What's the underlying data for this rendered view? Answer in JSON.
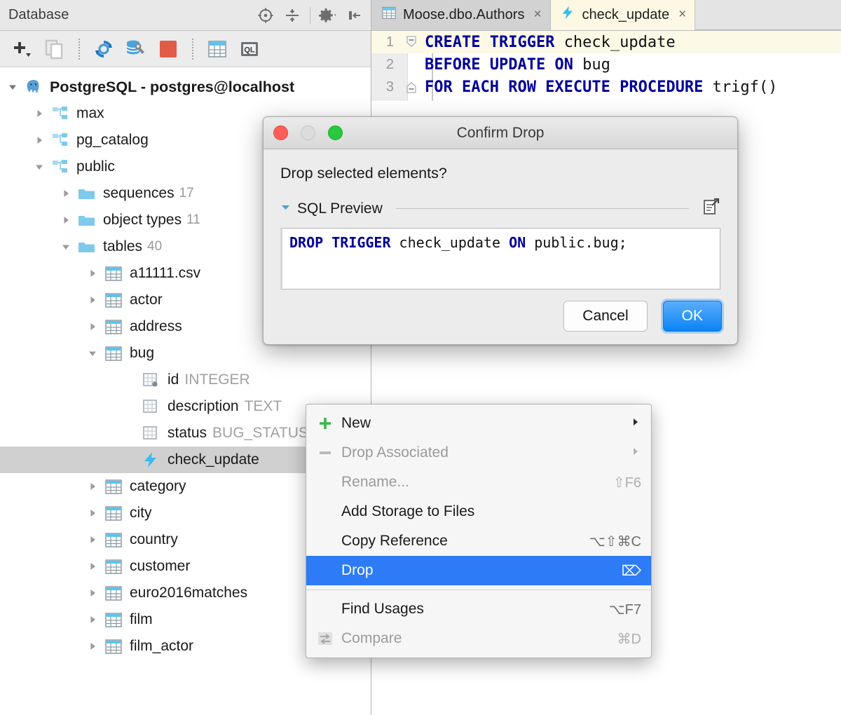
{
  "panel": {
    "title": "Database",
    "header_icons": [
      "scroll-from-source-icon",
      "collapse-all-icon",
      "settings-gear-icon",
      "hide-panel-icon"
    ],
    "toolbar_icons": [
      "add-icon",
      "duplicate-icon",
      "synchronize-icon",
      "data-source-properties-icon",
      "stop-icon",
      "table-editor-icon",
      "query-console-icon"
    ]
  },
  "tree": {
    "root": {
      "label": "PostgreSQL - postgres@localhost",
      "icon": "postgresql-elephant-icon"
    },
    "schemas": [
      {
        "label": "max",
        "icon": "schema-icon"
      },
      {
        "label": "pg_catalog",
        "icon": "schema-icon"
      },
      {
        "label": "public",
        "icon": "schema-icon"
      }
    ],
    "groups": [
      {
        "label": "sequences",
        "count": "17",
        "icon": "folder-icon"
      },
      {
        "label": "object types",
        "count": "11",
        "icon": "folder-icon"
      },
      {
        "label": "tables",
        "count": "40",
        "icon": "folder-icon"
      }
    ],
    "tables_before": [
      {
        "label": "a11111.csv"
      },
      {
        "label": "actor"
      },
      {
        "label": "address"
      }
    ],
    "expanded_table": {
      "label": "bug"
    },
    "columns": [
      {
        "label": "id",
        "type": "INTEGER",
        "icon": "primary-key-column-icon"
      },
      {
        "label": "description",
        "type": "TEXT",
        "icon": "column-icon"
      },
      {
        "label": "status",
        "type": "BUG_STATUS",
        "icon": "column-icon"
      }
    ],
    "trigger": {
      "label": "check_update",
      "icon": "trigger-icon"
    },
    "tables_after": [
      {
        "label": "category"
      },
      {
        "label": "city"
      },
      {
        "label": "country"
      },
      {
        "label": "customer"
      },
      {
        "label": "euro2016matches"
      },
      {
        "label": "film"
      },
      {
        "label": "film_actor"
      }
    ]
  },
  "tabs": [
    {
      "label": "Moose.dbo.Authors",
      "icon": "table-icon",
      "close": "×",
      "active": false
    },
    {
      "label": "check_update",
      "icon": "trigger-icon",
      "close": "×",
      "active": true
    }
  ],
  "editor": {
    "lines": [
      {
        "number": "1",
        "tokens": [
          {
            "t": "CREATE TRIGGER ",
            "kw": true
          },
          {
            "t": "check_update",
            "kw": false
          }
        ]
      },
      {
        "number": "2",
        "tokens": [
          {
            "t": "BEFORE UPDATE ON ",
            "kw": true
          },
          {
            "t": "bug",
            "kw": false
          }
        ]
      },
      {
        "number": "3",
        "tokens": [
          {
            "t": "FOR EACH ROW EXECUTE PROCEDURE ",
            "kw": true
          },
          {
            "t": "trigf()",
            "kw": false
          }
        ]
      }
    ]
  },
  "dialog": {
    "title": "Confirm Drop",
    "question": "Drop selected elements?",
    "sql_preview_label": "SQL Preview",
    "expand_icon": "open-in-editor-icon",
    "sql_tokens": [
      {
        "t": "DROP TRIGGER ",
        "kw": true
      },
      {
        "t": "check_update ",
        "kw": false
      },
      {
        "t": "ON ",
        "kw": true
      },
      {
        "t": "public.bug;",
        "kw": false
      }
    ],
    "cancel_label": "Cancel",
    "ok_label": "OK"
  },
  "context_menu": {
    "items": [
      {
        "label": "New",
        "icon": "plus-icon",
        "shortcut": "",
        "submenu": true,
        "disabled": false,
        "highlight": false
      },
      {
        "label": "Drop Associated",
        "icon": "minus-icon",
        "shortcut": "",
        "submenu": true,
        "disabled": true,
        "highlight": false
      },
      {
        "label": "Rename...",
        "icon": "",
        "shortcut": "⇧F6",
        "submenu": false,
        "disabled": true,
        "highlight": false
      },
      {
        "label": "Add Storage to Files",
        "icon": "",
        "shortcut": "",
        "submenu": false,
        "disabled": false,
        "highlight": false
      },
      {
        "label": "Copy Reference",
        "icon": "",
        "shortcut": "⌥⇧⌘C",
        "submenu": false,
        "disabled": false,
        "highlight": false
      },
      {
        "label": "Drop",
        "icon": "",
        "shortcut": "⌦",
        "submenu": false,
        "disabled": false,
        "highlight": true
      },
      {
        "separator": true
      },
      {
        "label": "Find Usages",
        "icon": "",
        "shortcut": "⌥F7",
        "submenu": false,
        "disabled": false,
        "highlight": false
      },
      {
        "label": "Compare",
        "icon": "compare-icon",
        "shortcut": "⌘D",
        "submenu": false,
        "disabled": true,
        "highlight": false
      }
    ]
  },
  "colors": {
    "selection_blue": "#2d7bf6",
    "keyword_navy": "#000099",
    "active_tab": "#fdf8e3",
    "tree_selected": "#d0d0d0",
    "ok_button": "#0a84f5"
  }
}
